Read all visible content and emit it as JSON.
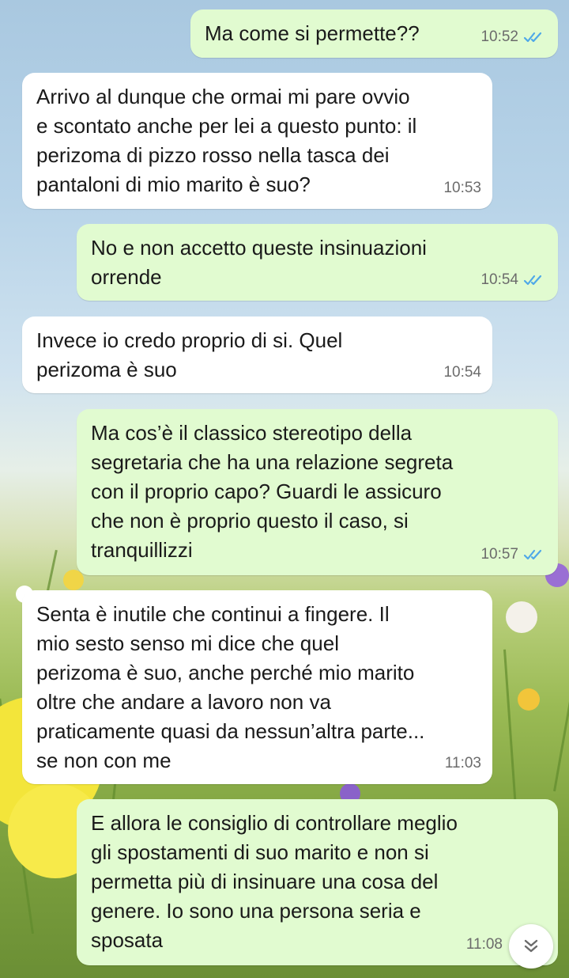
{
  "messages": [
    {
      "direction": "outgoing",
      "text": "Ma come si permette??",
      "time": "10:52",
      "status": "read"
    },
    {
      "direction": "incoming",
      "text": "Arrivo al dunque che ormai mi pare ovvio\ne scontato anche per lei a questo punto: il\nperizoma di pizzo rosso nella tasca dei\npantaloni di mio marito è suo?",
      "time": "10:53"
    },
    {
      "direction": "outgoing",
      "text": "No e non accetto queste insinuazioni\norrende",
      "time": "10:54",
      "status": "read"
    },
    {
      "direction": "incoming",
      "text": "Invece io credo proprio di si. Quel\nperizoma è suo",
      "time": "10:54"
    },
    {
      "direction": "outgoing",
      "text": "Ma cos’è il classico stereotipo della\nsegretaria che ha una relazione segreta\ncon il proprio capo? Guardi le assicuro\nche non è proprio questo il caso, si\ntranquillizzi",
      "time": "10:57",
      "status": "read"
    },
    {
      "direction": "incoming",
      "text": "Senta è inutile che continui a fingere. Il\nmio sesto senso mi dice che quel\nperizoma è suo, anche perché mio marito\noltre che andare a lavoro non va\npraticamente quasi da nessun’altra parte...\nse non con me",
      "time": "11:03"
    },
    {
      "direction": "outgoing",
      "text": "E allora le consiglio di controllare meglio\ngli spostamenti di suo marito e non si\npermetta più di insinuare una cosa del\ngenere. Io sono una persona seria e\nsposata",
      "time": "11:08",
      "status": "read"
    }
  ],
  "colors": {
    "outgoing_bubble": "#e1fbd0",
    "incoming_bubble": "#ffffff",
    "read_ticks": "#4fa8e8",
    "meta_text": "#6b6b6b"
  },
  "icons": {
    "read_receipt": "double-check-icon",
    "scroll_down": "double-chevron-down-icon"
  }
}
